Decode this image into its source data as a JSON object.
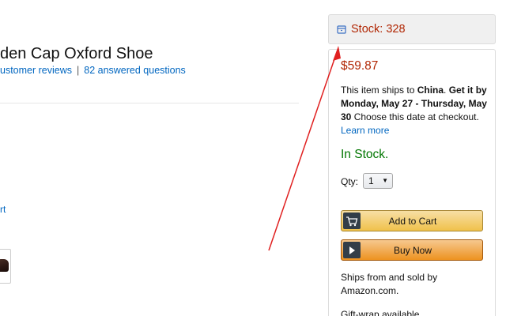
{
  "product": {
    "title": "den Cap Oxford Shoe",
    "reviews_text": "ustomer reviews",
    "separator": "|",
    "questions_text": "82 answered questions",
    "cropped_link": "rt"
  },
  "stock_banner": {
    "text": "Stock: 328",
    "icon": "box-icon"
  },
  "buy_box": {
    "price": "$59.87",
    "ships_prefix": "This item ships to ",
    "ships_country": "China",
    "ships_mid": ". ",
    "ships_get_it": "Get it by Monday, May 27 - Thursday, May 30",
    "ships_suffix": " Choose this date at checkout.",
    "learn_more": "Learn more",
    "availability": "In Stock.",
    "qty_label": "Qty:",
    "qty_value": "1",
    "add_to_cart": "Add to Cart",
    "buy_now": "Buy Now",
    "seller_text": "Ships from and sold by Amazon.com.",
    "gift_wrap": "Gift-wrap available."
  },
  "colors": {
    "price": "#b12704",
    "in_stock": "#007600",
    "link": "#0066c0",
    "annotation_arrow": "#e02020"
  }
}
